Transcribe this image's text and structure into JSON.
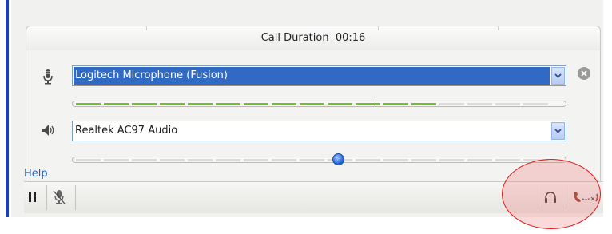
{
  "header": {
    "call_duration": "Call Duration  00:16"
  },
  "microphone": {
    "icon": "microphone-icon",
    "selected_device": "Logitech Microphone (Fusion)",
    "level_fraction": 0.78,
    "highlight_color": "#316ac5"
  },
  "speaker": {
    "icon": "speaker-icon",
    "selected_device": "Realtek AC97 Audio",
    "volume_fraction": 0.54
  },
  "help_label": "Help",
  "toolbar": {
    "left_buttons": [
      "pause-icon",
      "mute-microphone-icon"
    ],
    "right_buttons": [
      "headset-icon",
      "hang-up-phone-icon"
    ]
  },
  "colors": {
    "meter_on": "#74c02a",
    "accent": "#1c3ec4",
    "annotation": "#e01818"
  }
}
